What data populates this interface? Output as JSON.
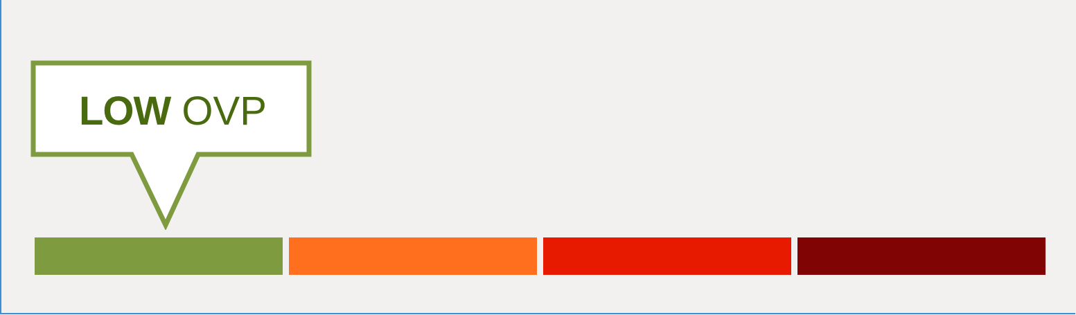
{
  "indicator": {
    "level_word": "LOW",
    "suffix_word": "OVP",
    "current_level": "low",
    "accent_color": "#7f9b3f",
    "text_color": "#4a6a10"
  },
  "scale": {
    "segments": [
      {
        "level": "low",
        "color": "#7f9b3f"
      },
      {
        "level": "moderate",
        "color": "#ff6f1d"
      },
      {
        "level": "high",
        "color": "#e71a00"
      },
      {
        "level": "very-high",
        "color": "#800404"
      }
    ]
  }
}
